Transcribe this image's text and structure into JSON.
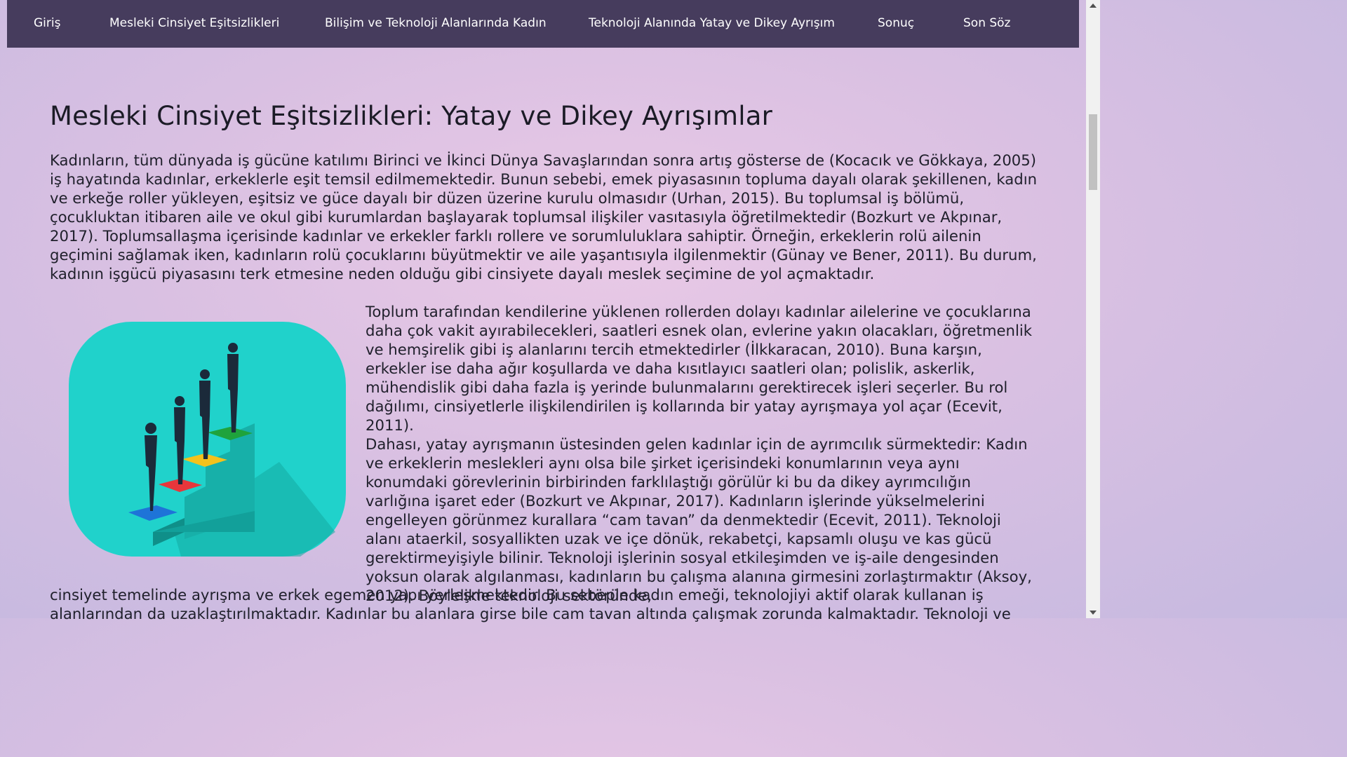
{
  "nav": {
    "items": [
      {
        "label": "Giriş"
      },
      {
        "label": "Mesleki Cinsiyet Eşitsizlikleri"
      },
      {
        "label": "Bilişim ve Teknoloji Alanlarında Kadın"
      },
      {
        "label": "Teknoloji Alanında Yatay ve Dikey Ayrışım"
      },
      {
        "label": "Sonuç"
      },
      {
        "label": "Son Söz"
      }
    ]
  },
  "article": {
    "title": "Mesleki Cinsiyet Eşitsizlikleri: Yatay ve Dikey Ayrışımlar",
    "p1": "Kadınların, tüm dünyada iş gücüne katılımı Birinci ve İkinci Dünya Savaşlarından sonra artış gösterse de (Kocacık ve Gökkaya, 2005) iş hayatında kadınlar, erkeklerle eşit temsil edilmemektedir. Bunun sebebi, emek piyasasının topluma dayalı olarak şekillenen, kadın ve erkeğe roller yükleyen, eşitsiz ve güce dayalı bir düzen üzerine kurulu olmasıdır (Urhan, 2015). Bu toplumsal iş bölümü, çocukluktan itibaren aile ve okul gibi kurumlardan başlayarak toplumsal ilişkiler vasıtasıyla öğretilmektedir (Bozkurt ve Akpınar, 2017). Toplumsallaşma içerisinde kadınlar ve erkekler farklı rollere ve sorumluluklara sahiptir. Örneğin, erkeklerin rolü ailenin geçimini sağlamak iken, kadınların rolü çocuklarını büyütmektir ve aile yaşantısıyla ilgilenmektir (Günay ve Bener, 2011). Bu durum, kadının işgücü piyasasını terk etmesine neden olduğu gibi cinsiyete dayalı meslek seçimine de yol açmaktadır.",
    "p2": "Toplum tarafından kendilerine yüklenen rollerden dolayı kadınlar ailelerine ve çocuklarına daha çok vakit ayırabilecekleri, saatleri esnek olan, evlerine yakın olacakları, öğretmenlik ve hemşirelik gibi iş alanlarını tercih etmektedirler (İlkkaracan, 2010). Buna karşın, erkekler ise daha ağır koşullarda ve daha kısıtlayıcı saatleri olan; polislik, askerlik, mühendislik gibi daha fazla iş yerinde bulunmalarını gerektirecek işleri seçerler. Bu rol dağılımı, cinsiyetlerle ilişkilendirilen iş kollarında bir yatay ayrışmaya yol açar (Ecevit, 2011).",
    "p3": "Dahası, yatay ayrışmanın üstesinden gelen kadınlar için de ayrımcılık sürmektedir: Kadın ve erkeklerin meslekleri aynı olsa bile şirket içerisindeki konumlarının veya aynı konumdaki görevlerinin birbirinden farklılaştığı görülür ki bu da dikey ayrımcılığın varlığına işaret eder (Bozkurt ve Akpınar, 2017). Kadınların işlerinde yükselmelerini engelleyen görünmez kurallara “cam tavan” da denmektedir (Ecevit, 2011). Teknoloji alanı ataerkil, sosyallikten uzak ve içe dönük, rekabetçi, kapsamlı oluşu ve kas gücü gerektirmeyişiyle bilinir. Teknoloji işlerinin sosyal etkileşimden ve iş-aile dengesinden yoksun olarak algılanması, kadınların bu çalışma alanına girmesini zorlaştırmaktır (Aksoy, 2012). Böylelikle teknoloji sektöründe,",
    "p4": "cinsiyet temelinde ayrışma ve erkek egemen yapı yerleşmektedir. Bu sebeple kadın emeği, teknolojiyi aktif olarak kullanan iş alanlarından da uzaklaştırılmaktadır. Kadınlar bu alanlara girse bile cam tavan altında çalışmak zorunda kalmaktadır. Teknoloji ve"
  },
  "illustration": {
    "icon": "career-stairs-illustration",
    "bg_color": "#20d2cb",
    "step_colors": [
      "#1e74d8",
      "#e8363b",
      "#f4c21c",
      "#1fa33c"
    ]
  }
}
